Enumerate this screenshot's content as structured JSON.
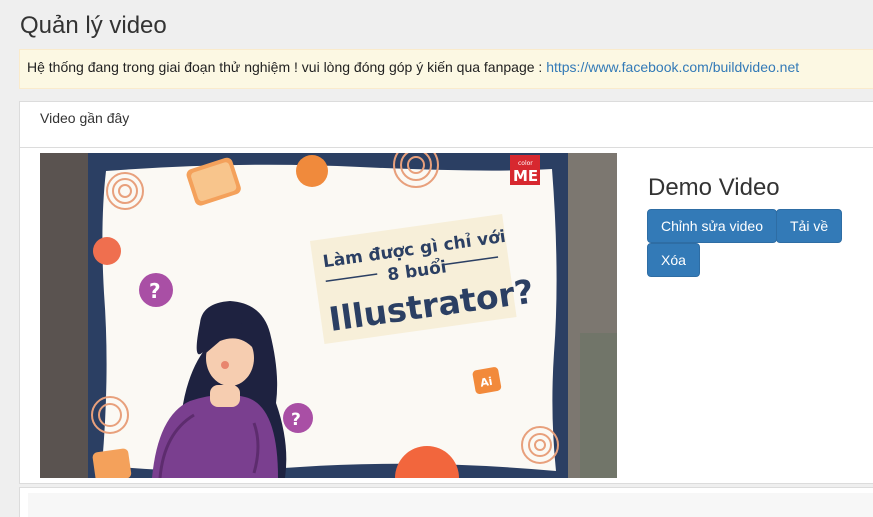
{
  "page": {
    "title": "Quản lý video"
  },
  "notice": {
    "text": "Hệ thống đang trong giai đoạn thử nghiệm ! vui lòng đóng góp ý kiến qua fanpage : ",
    "link": "https://www.facebook.com/buildvideo.net"
  },
  "recent": {
    "heading": "Video gần đây"
  },
  "video": {
    "title": "Demo Video",
    "thumbnail": {
      "line1": "Làm được gì chỉ với",
      "line2": "8 buổi",
      "line3": "Illustrator?",
      "logo_small": "color",
      "logo_big": "ME",
      "ai_badge": "Ai",
      "question_mark": "?"
    },
    "actions": {
      "edit": "Chỉnh sửa video",
      "download": "Tải về",
      "delete": "Xóa"
    }
  },
  "colors": {
    "primary": "#337ab7",
    "notice_bg": "#fcf8e3",
    "thumb_navy": "#2b3f63",
    "thumb_purple": "#7a3f8f",
    "thumb_orange": "#f08a3c",
    "logo_red": "#d7282f"
  }
}
